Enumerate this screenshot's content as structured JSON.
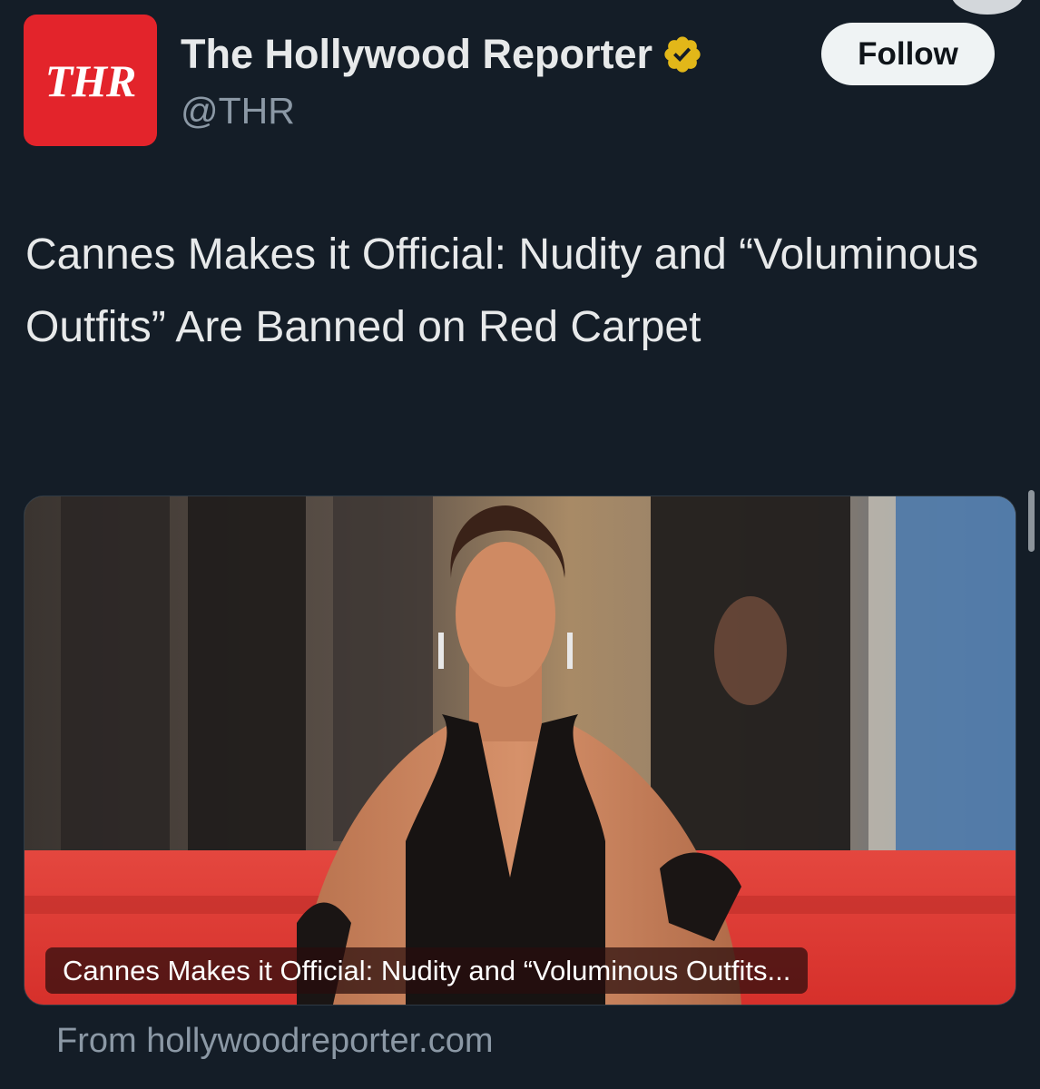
{
  "account": {
    "avatar_text": "THR",
    "display_name": "The Hollywood Reporter",
    "handle": "@THR",
    "verified_icon": "verified-badge-gold"
  },
  "follow_button": {
    "label": "Follow"
  },
  "tweet": {
    "text": "Cannes Makes it Official: Nudity and “Voluminous Outfits” Are Banned on Red Carpet"
  },
  "link_card": {
    "image_alt": "Red carpet photo",
    "caption": "Cannes Makes it Official: Nudity and “Voluminous Outfits...",
    "source": "From hollywoodreporter.com"
  },
  "colors": {
    "background": "#141d27",
    "avatar": "#e3242b",
    "verified_badge": "#e2b719",
    "text_primary": "#e7e9ea",
    "text_secondary": "#8b98a5",
    "follow_bg": "#eff3f4"
  }
}
